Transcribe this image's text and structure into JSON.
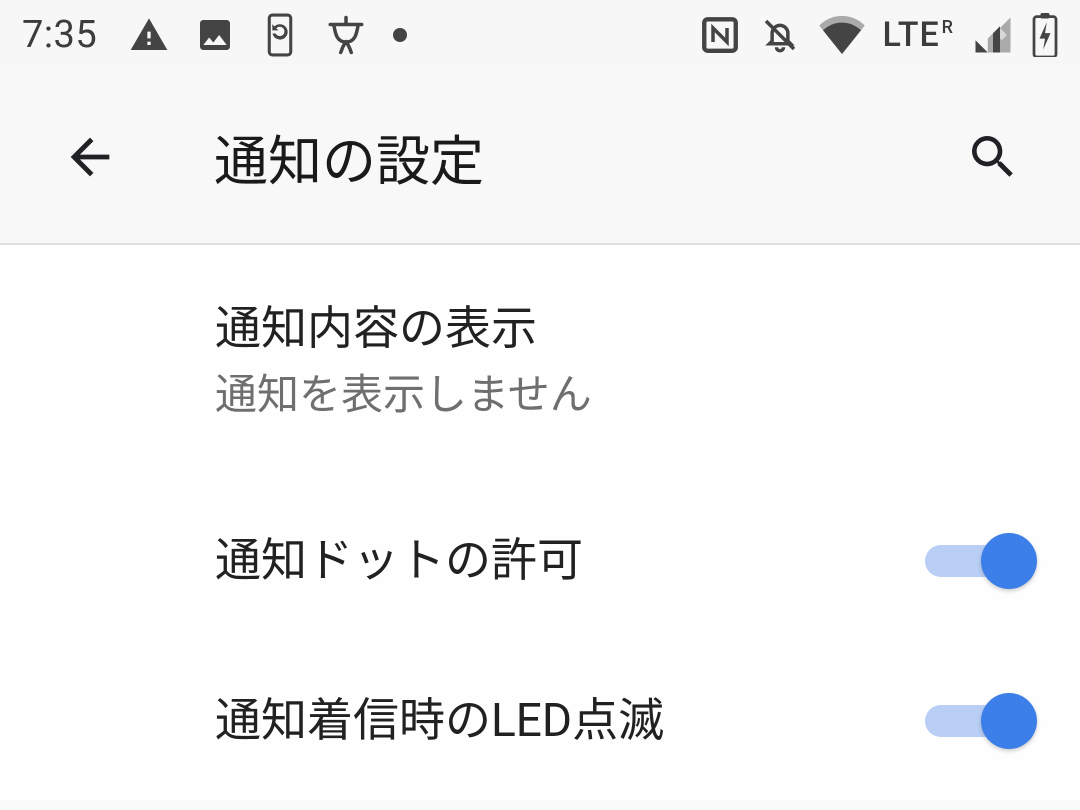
{
  "status": {
    "time": "7:35",
    "lte": "LTE",
    "roaming": "R"
  },
  "header": {
    "title": "通知の設定"
  },
  "settings": {
    "notification_content": {
      "title": "通知内容の表示",
      "subtitle": "通知を表示しません"
    },
    "allow_dot": {
      "title": "通知ドットの許可",
      "enabled": true
    },
    "led_blink": {
      "title": "通知着信時のLED点滅",
      "enabled": true
    }
  }
}
